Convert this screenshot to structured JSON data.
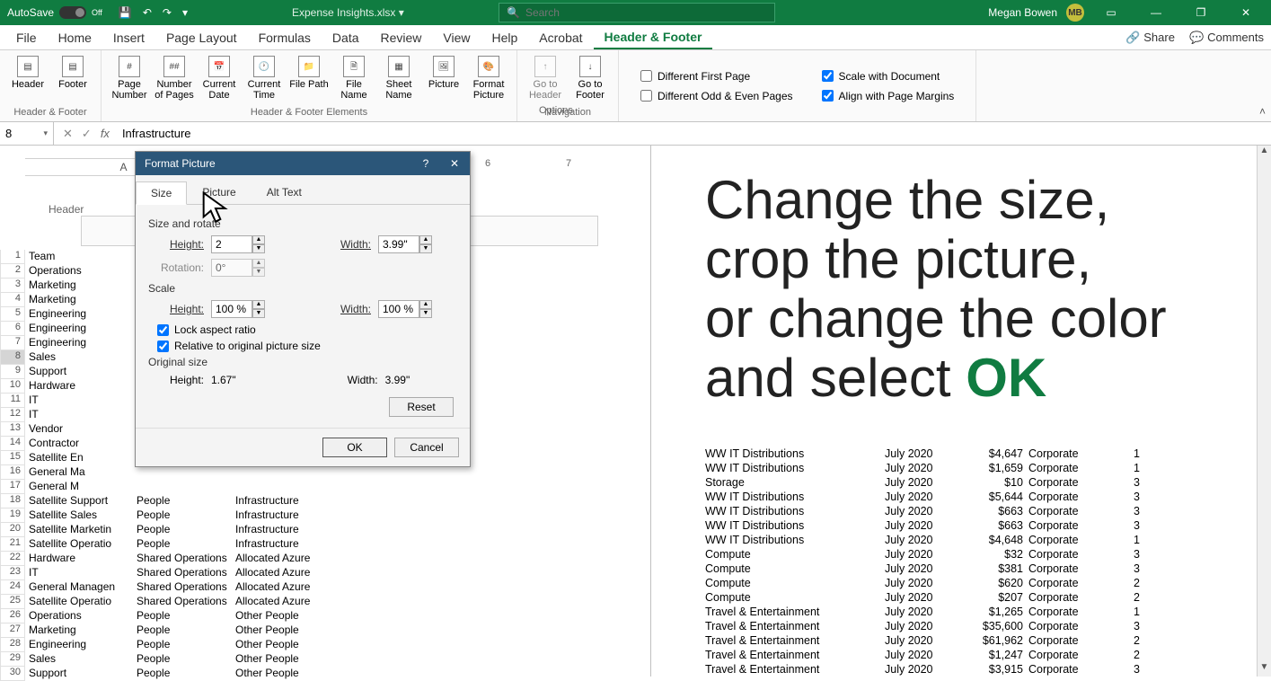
{
  "titleBar": {
    "autosave_label": "AutoSave",
    "autosave_state": "Off",
    "filename": "Expense Insights.xlsx",
    "search_placeholder": "Search",
    "user_name": "Megan Bowen",
    "user_initials": "MB"
  },
  "tabs": {
    "file": "File",
    "home": "Home",
    "insert": "Insert",
    "page_layout": "Page Layout",
    "formulas": "Formulas",
    "data": "Data",
    "review": "Review",
    "view": "View",
    "help": "Help",
    "acrobat": "Acrobat",
    "header_footer": "Header & Footer",
    "share": "Share",
    "comments": "Comments"
  },
  "ribbon": {
    "group1_label": "Header & Footer",
    "group2_label": "Header & Footer Elements",
    "group3_label": "Navigation",
    "group4_label": "Options",
    "header": "Header",
    "footer": "Footer",
    "page_number": "Page Number",
    "number_pages": "Number of Pages",
    "current_date": "Current Date",
    "current_time": "Current Time",
    "file_path": "File Path",
    "file_name": "File Name",
    "sheet_name": "Sheet Name",
    "picture": "Picture",
    "format_picture": "Format Picture",
    "go_header": "Go to Header",
    "go_footer": "Go to Footer",
    "diff_first": "Different First Page",
    "diff_odd_even": "Different Odd & Even Pages",
    "scale_doc": "Scale with Document",
    "align_margins": "Align with Page Margins"
  },
  "formulaBar": {
    "name_box": "8",
    "fx": "fx",
    "formula": "Infrastructure"
  },
  "columns": {
    "A": "A",
    "six": "6",
    "seven": "7"
  },
  "sheet": {
    "header_label": "Header",
    "rows": [
      {
        "n": "1",
        "a": "Team",
        "b": "",
        "c": ""
      },
      {
        "n": "2",
        "a": "Operations",
        "b": "",
        "c": ""
      },
      {
        "n": "3",
        "a": "Marketing",
        "b": "",
        "c": ""
      },
      {
        "n": "4",
        "a": "Marketing",
        "b": "",
        "c": ""
      },
      {
        "n": "5",
        "a": "Engineering",
        "b": "",
        "c": ""
      },
      {
        "n": "6",
        "a": "Engineering",
        "b": "",
        "c": ""
      },
      {
        "n": "7",
        "a": "Engineering",
        "b": "",
        "c": ""
      },
      {
        "n": "8",
        "a": "Sales",
        "b": "",
        "c": ""
      },
      {
        "n": "9",
        "a": "Support",
        "b": "",
        "c": ""
      },
      {
        "n": "10",
        "a": "Hardware",
        "b": "",
        "c": ""
      },
      {
        "n": "11",
        "a": "IT",
        "b": "",
        "c": ""
      },
      {
        "n": "12",
        "a": "IT",
        "b": "",
        "c": ""
      },
      {
        "n": "13",
        "a": "Vendor",
        "b": "",
        "c": ""
      },
      {
        "n": "14",
        "a": "Contractor",
        "b": "",
        "c": ""
      },
      {
        "n": "15",
        "a": "Satellite En",
        "b": "",
        "c": ""
      },
      {
        "n": "16",
        "a": "General Ma",
        "b": "",
        "c": ""
      },
      {
        "n": "17",
        "a": "General M",
        "b": "",
        "c": ""
      },
      {
        "n": "18",
        "a": "Satellite Support",
        "b": "People",
        "c": "Infrastructure"
      },
      {
        "n": "19",
        "a": "Satellite Sales",
        "b": "People",
        "c": "Infrastructure"
      },
      {
        "n": "20",
        "a": "Satellite Marketin",
        "b": "People",
        "c": "Infrastructure"
      },
      {
        "n": "21",
        "a": "Satellite Operatio",
        "b": "People",
        "c": "Infrastructure"
      },
      {
        "n": "22",
        "a": "Hardware",
        "b": "Shared Operations",
        "c": "Allocated Azure"
      },
      {
        "n": "23",
        "a": "IT",
        "b": "Shared Operations",
        "c": "Allocated Azure"
      },
      {
        "n": "24",
        "a": "General Managen",
        "b": "Shared Operations",
        "c": "Allocated Azure"
      },
      {
        "n": "25",
        "a": "Satellite Operatio",
        "b": "Shared Operations",
        "c": "Allocated Azure"
      },
      {
        "n": "26",
        "a": "Operations",
        "b": "People",
        "c": "Other People"
      },
      {
        "n": "27",
        "a": "Marketing",
        "b": "People",
        "c": "Other People"
      },
      {
        "n": "28",
        "a": "Engineering",
        "b": "People",
        "c": "Other People"
      },
      {
        "n": "29",
        "a": "Sales",
        "b": "People",
        "c": "Other People"
      },
      {
        "n": "30",
        "a": "Support",
        "b": "People",
        "c": "Other People"
      }
    ]
  },
  "instruction": {
    "line1": "Change the size,",
    "line2": "crop the picture,",
    "line3": "or change the color",
    "line4a": "and select ",
    "line4b": "OK"
  },
  "rightGrid": [
    {
      "a": "WW IT Distributions",
      "b": "July 2020",
      "c": "$4,647",
      "d": "Corporate",
      "e": "1"
    },
    {
      "a": "WW IT Distributions",
      "b": "July 2020",
      "c": "$1,659",
      "d": "Corporate",
      "e": "1"
    },
    {
      "a": "Storage",
      "b": "July 2020",
      "c": "$10",
      "d": "Corporate",
      "e": "3"
    },
    {
      "a": "WW IT Distributions",
      "b": "July 2020",
      "c": "$5,644",
      "d": "Corporate",
      "e": "3"
    },
    {
      "a": "WW IT Distributions",
      "b": "July 2020",
      "c": "$663",
      "d": "Corporate",
      "e": "3"
    },
    {
      "a": "WW IT Distributions",
      "b": "July 2020",
      "c": "$663",
      "d": "Corporate",
      "e": "3"
    },
    {
      "a": "WW IT Distributions",
      "b": "July 2020",
      "c": "$4,648",
      "d": "Corporate",
      "e": "1"
    },
    {
      "a": "Compute",
      "b": "July 2020",
      "c": "$32",
      "d": "Corporate",
      "e": "3"
    },
    {
      "a": "Compute",
      "b": "July 2020",
      "c": "$381",
      "d": "Corporate",
      "e": "3"
    },
    {
      "a": "Compute",
      "b": "July 2020",
      "c": "$620",
      "d": "Corporate",
      "e": "2"
    },
    {
      "a": "Compute",
      "b": "July 2020",
      "c": "$207",
      "d": "Corporate",
      "e": "2"
    },
    {
      "a": "Travel & Entertainment",
      "b": "July 2020",
      "c": "$1,265",
      "d": "Corporate",
      "e": "1"
    },
    {
      "a": "Travel & Entertainment",
      "b": "July 2020",
      "c": "$35,600",
      "d": "Corporate",
      "e": "3"
    },
    {
      "a": "Travel & Entertainment",
      "b": "July 2020",
      "c": "$61,962",
      "d": "Corporate",
      "e": "2"
    },
    {
      "a": "Travel & Entertainment",
      "b": "July 2020",
      "c": "$1,247",
      "d": "Corporate",
      "e": "2"
    },
    {
      "a": "Travel & Entertainment",
      "b": "July 2020",
      "c": "$3,915",
      "d": "Corporate",
      "e": "3"
    }
  ],
  "dialog": {
    "title": "Format Picture",
    "tab_size": "Size",
    "tab_picture": "Picture",
    "tab_alt": "Alt Text",
    "section_size_rotate": "Size and rotate",
    "height_label": "Height:",
    "width_label": "Width:",
    "rotation_label": "Rotation:",
    "height_val": "2",
    "width_val": "3.99\"",
    "rotation_val": "0°",
    "section_scale": "Scale",
    "scale_height": "100 %",
    "scale_width": "100 %",
    "lock_aspect": "Lock aspect ratio",
    "relative_original": "Relative to original picture size",
    "section_original": "Original size",
    "orig_height": "1.67\"",
    "orig_width": "3.99\"",
    "reset": "Reset",
    "ok": "OK",
    "cancel": "Cancel"
  }
}
